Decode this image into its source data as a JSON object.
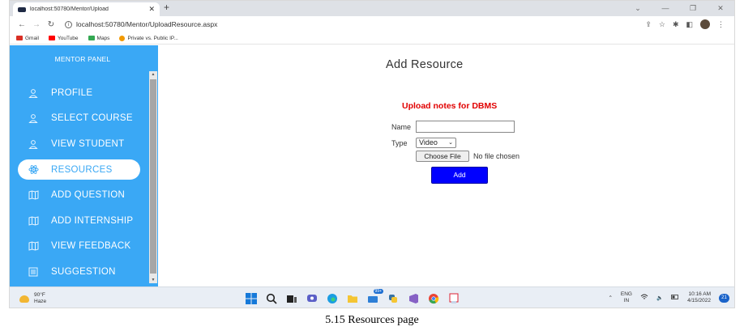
{
  "browser": {
    "tab_title": "localhost:50780/Mentor/Upload",
    "tab_close": "✕",
    "new_tab": "+",
    "url": "localhost:50780/Mentor/UploadResource.aspx",
    "bookmarks": [
      {
        "label": "Gmail",
        "color": "#d93025"
      },
      {
        "label": "YouTube",
        "color": "#ff0000"
      },
      {
        "label": "Maps",
        "color": "#34a853"
      },
      {
        "label": "Private vs. Public IP...",
        "color": "#f29900"
      }
    ]
  },
  "sidebar": {
    "title": "MENTOR PANEL",
    "items": [
      {
        "label": "PROFILE",
        "icon": "user-icon"
      },
      {
        "label": "SELECT COURSE",
        "icon": "user-icon"
      },
      {
        "label": "VIEW STUDENT",
        "icon": "user-icon"
      },
      {
        "label": "RESOURCES",
        "icon": "atom-icon",
        "active": true
      },
      {
        "label": "ADD QUESTION",
        "icon": "map-icon"
      },
      {
        "label": "ADD INTERNSHIP",
        "icon": "map-icon"
      },
      {
        "label": "VIEW FEEDBACK",
        "icon": "map-icon"
      },
      {
        "label": "SUGGESTION",
        "icon": "list-icon"
      }
    ],
    "accent_color": "#3aa8f5"
  },
  "main": {
    "heading": "Add Resource",
    "upload_title": "Upload notes for DBMS",
    "upload_title_color": "#e10000",
    "name_label": "Name",
    "name_value": "",
    "type_label": "Type",
    "type_selected": "Video",
    "file_button": "Choose File",
    "file_status": "No file chosen",
    "add_button": "Add",
    "add_button_color": "#0000ff"
  },
  "taskbar": {
    "temperature": "90°F",
    "condition": "Haze",
    "language": "ENG",
    "region": "IN",
    "time": "10:16 AM",
    "date": "4/15/2022",
    "notifications": "21",
    "badge": "99+"
  },
  "caption": "5.15 Resources page"
}
